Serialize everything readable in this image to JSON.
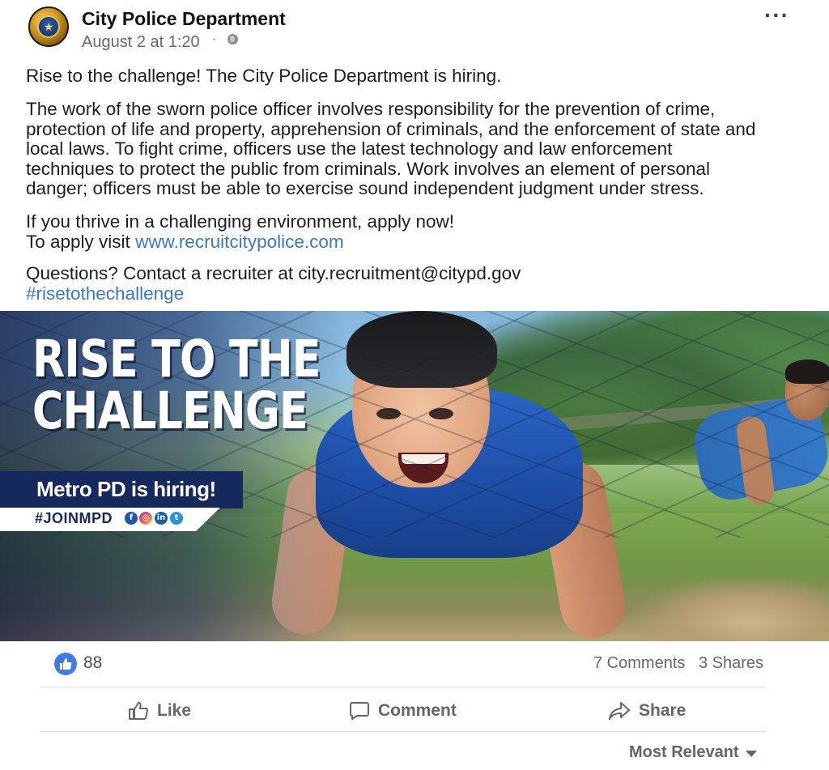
{
  "post": {
    "page_name": "City Police Department",
    "timestamp": "August 2 at 1:20",
    "separator": "·",
    "audience_icon": "globe-icon",
    "more_icon": "more-options-icon",
    "more_label": "···"
  },
  "body": {
    "line1": "Rise to the challenge! The City Police Department is hiring.",
    "para2": [
      "The work of the sworn police officer involves responsibility for the prevention of crime,",
      "protection of life and property, apprehension of criminals, and the enforcement of state and",
      "local laws. To fight crime, officers use the latest technology and law enforcement",
      "techniques to protect the public from criminals. Work involves an element of personal",
      "danger; officers must be able to exercise sound independent judgment under stress."
    ],
    "para3_line1": "If you thrive in a challenging environment, apply now!",
    "para3_prefix": "To apply visit ",
    "apply_link": "www.recruitcitypolice.com",
    "para4_line1": "Questions? Contact a recruiter at city.recruitment@citypd.gov",
    "hashtag": "#risetothechallenge"
  },
  "image": {
    "headline_line1": "RISE TO THE",
    "headline_line2": "CHALLENGE",
    "hiring": "Metro PD is hiring!",
    "tag": "#JOINMPD",
    "social_icons": [
      "facebook-icon",
      "instagram-icon",
      "linkedin-icon",
      "twitter-icon"
    ],
    "social_glyphs": [
      "f",
      "◎",
      "in",
      "t"
    ]
  },
  "reactions": {
    "like_count": "88",
    "comments": "7 Comments",
    "shares": "3 Shares"
  },
  "actions": {
    "like": "Like",
    "comment": "Comment",
    "share": "Share"
  },
  "comments_sort": {
    "label": "Most Relevant"
  },
  "colors": {
    "link": "#3b78c4",
    "like_blue": "#3e7be6",
    "navy": "#16295f",
    "muted": "#65676b"
  }
}
